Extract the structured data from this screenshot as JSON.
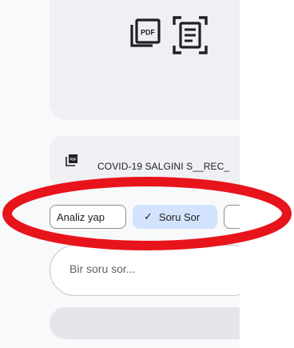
{
  "file": {
    "name": "COVID-19 SALGINI S__REC_"
  },
  "chips": {
    "analyze_label": "Analiz yap",
    "ask_label": "Soru Sor",
    "check_glyph": "✓",
    "third_label": ""
  },
  "query": {
    "placeholder": "Bir soru sor..."
  },
  "annotation": {
    "color": "#e8141c"
  },
  "icons": [
    "pdf-icon",
    "document-scan-icon",
    "pdf-file-icon",
    "check-icon"
  ]
}
